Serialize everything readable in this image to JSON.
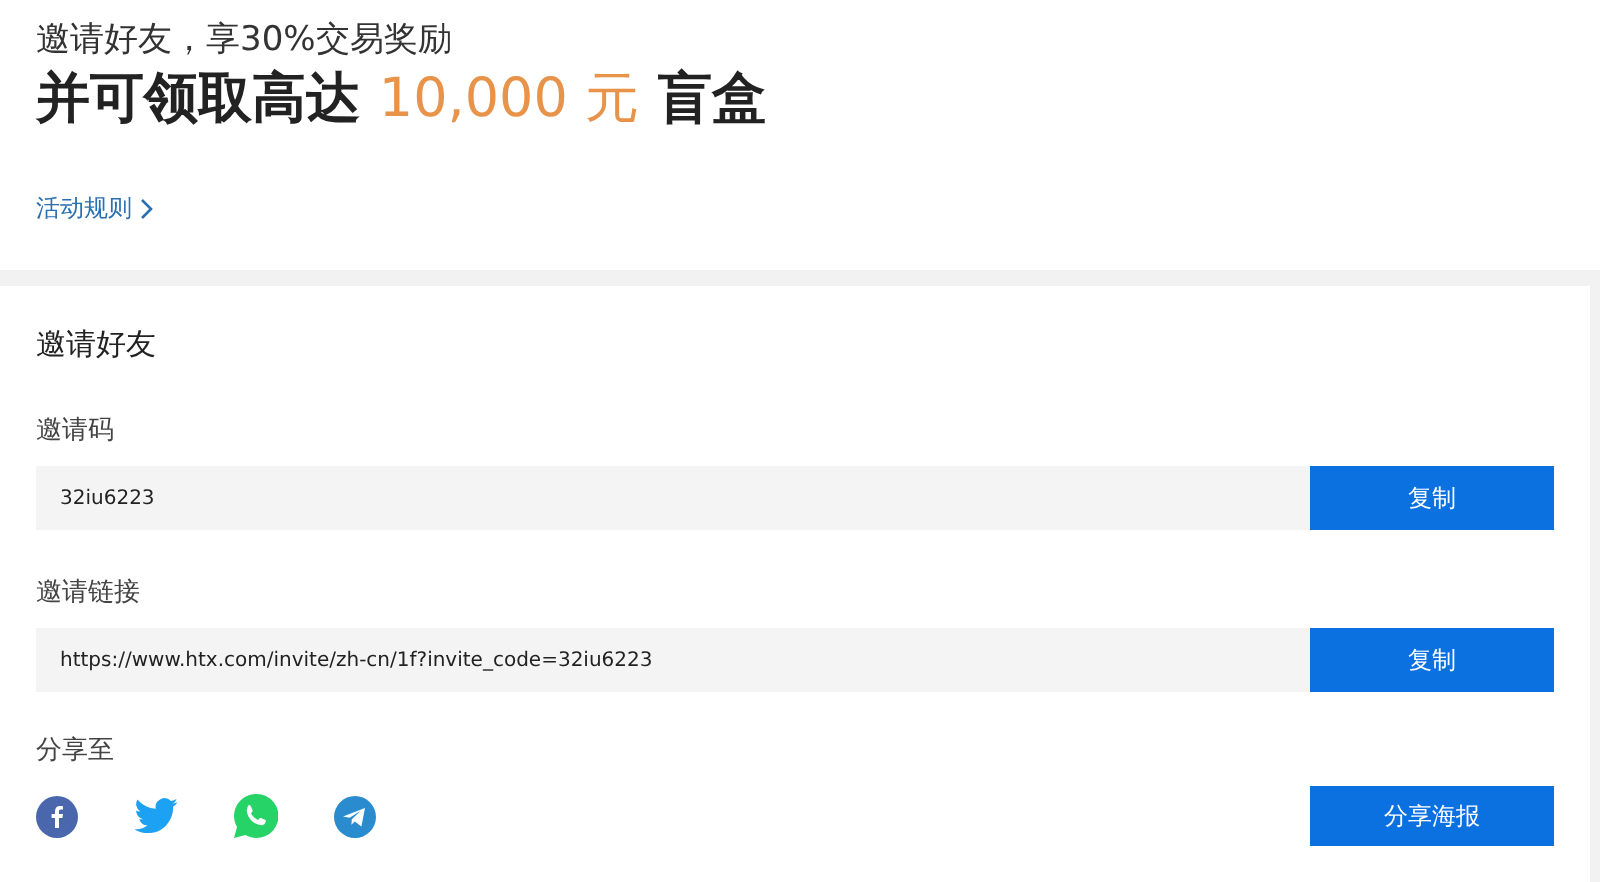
{
  "header": {
    "subtitle": "邀请好友，享30%交易奖励",
    "headline": {
      "prefix": "并可领取高达",
      "amount": "10,000 元",
      "suffix": "盲盒"
    },
    "rules_link": "活动规则"
  },
  "card": {
    "title": "邀请好友",
    "fields": [
      {
        "label": "邀请码",
        "value": "32iu6223",
        "button": "复制"
      },
      {
        "label": "邀请链接",
        "value": "https://www.htx.com/invite/zh-cn/1f?invite_code=32iu6223",
        "button": "复制"
      }
    ],
    "share": {
      "label": "分享至",
      "icons": [
        {
          "kind": "facebook"
        },
        {
          "kind": "twitter"
        },
        {
          "kind": "whatsapp"
        },
        {
          "kind": "telegram"
        }
      ],
      "button": "分享海报"
    }
  }
}
